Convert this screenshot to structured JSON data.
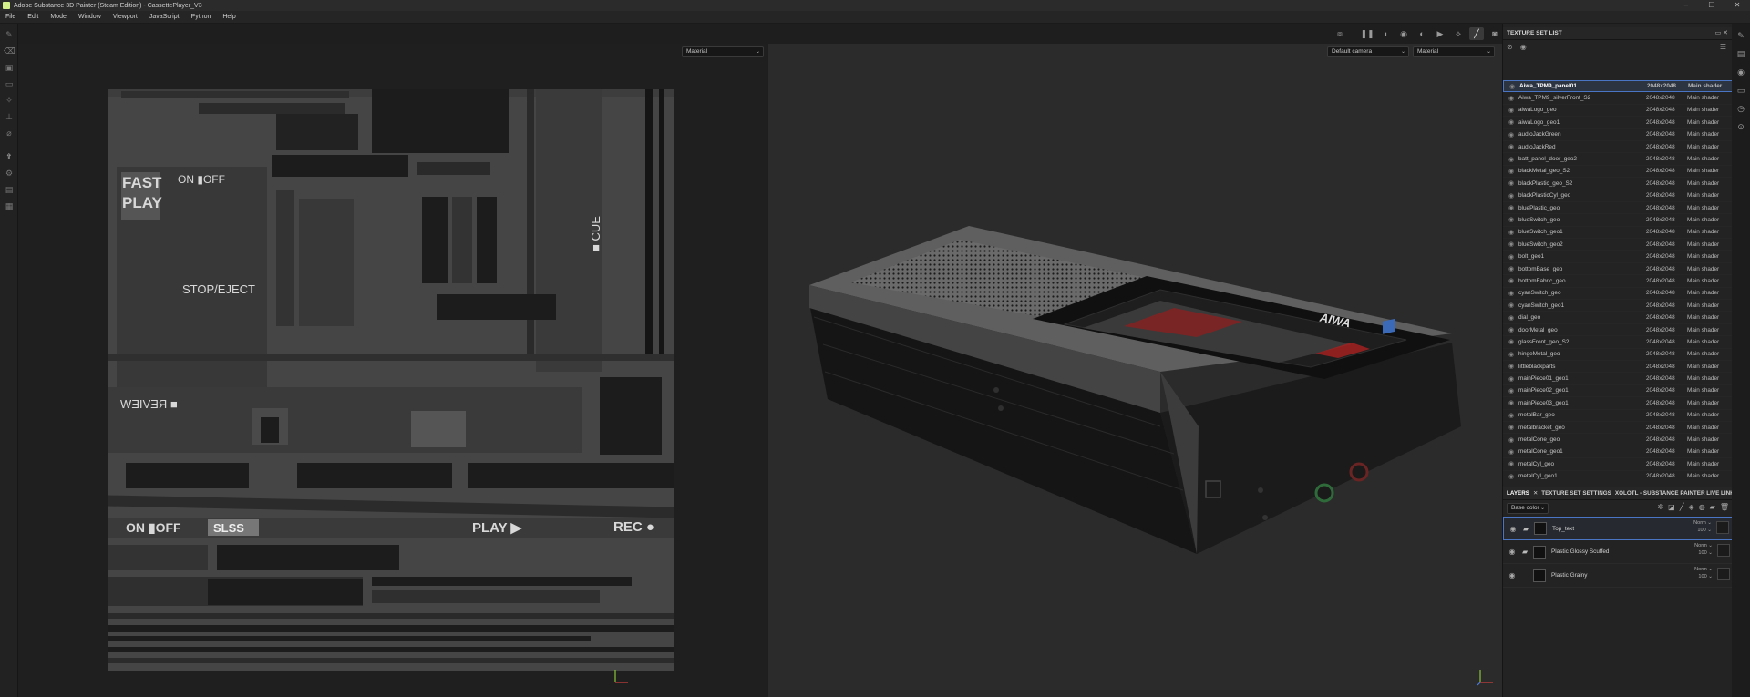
{
  "window": {
    "title": "Adobe Substance 3D Painter (Steam Edition) - CassettePlayer_V3",
    "controls": [
      "–",
      "☐",
      "✕"
    ]
  },
  "menu": [
    "File",
    "Edit",
    "Mode",
    "Window",
    "Viewport",
    "JavaScript",
    "Python",
    "Help"
  ],
  "viewport2d": {
    "channel_dropdown": "Material"
  },
  "viewport3d": {
    "camera_dropdown": "Default camera",
    "channel_dropdown": "Material"
  },
  "uv_labels": {
    "fast": "FAST",
    "play": "PLAY",
    "onoff": "ON ▮OFF",
    "stop_eject": "STOP/EJECT",
    "cue": "■ CUE",
    "review": "■ REVIEW",
    "onoff2": "ON ▮OFF",
    "slss": "SLSS",
    "play2": "PLAY ▶",
    "rec": "REC ●"
  },
  "device_label": "AIWA",
  "texture_set_list": {
    "title": "TEXTURE SET LIST",
    "rows": [
      {
        "name": "Aiwa_TPM9_panel01",
        "res": "2048x2048",
        "shader": "Main shader",
        "selected": true
      },
      {
        "name": "Aiwa_TPM9_silverFront_S2",
        "res": "2048x2048",
        "shader": "Main shader"
      },
      {
        "name": "aiwaLogo_geo",
        "res": "2048x2048",
        "shader": "Main shader"
      },
      {
        "name": "aiwaLogo_geo1",
        "res": "2048x2048",
        "shader": "Main shader"
      },
      {
        "name": "audioJackGreen",
        "res": "2048x2048",
        "shader": "Main shader"
      },
      {
        "name": "audioJackRed",
        "res": "2048x2048",
        "shader": "Main shader"
      },
      {
        "name": "batt_panel_door_geo2",
        "res": "2048x2048",
        "shader": "Main shader"
      },
      {
        "name": "blackMetal_geo_S2",
        "res": "2048x2048",
        "shader": "Main shader"
      },
      {
        "name": "blackPlastic_geo_S2",
        "res": "2048x2048",
        "shader": "Main shader"
      },
      {
        "name": "blackPlasticCyl_geo",
        "res": "2048x2048",
        "shader": "Main shader"
      },
      {
        "name": "bluePlastic_geo",
        "res": "2048x2048",
        "shader": "Main shader"
      },
      {
        "name": "blueSwitch_geo",
        "res": "2048x2048",
        "shader": "Main shader"
      },
      {
        "name": "blueSwitch_geo1",
        "res": "2048x2048",
        "shader": "Main shader"
      },
      {
        "name": "blueSwitch_geo2",
        "res": "2048x2048",
        "shader": "Main shader"
      },
      {
        "name": "bolt_geo1",
        "res": "2048x2048",
        "shader": "Main shader"
      },
      {
        "name": "bottomBase_geo",
        "res": "2048x2048",
        "shader": "Main shader"
      },
      {
        "name": "bottomFabric_geo",
        "res": "2048x2048",
        "shader": "Main shader"
      },
      {
        "name": "cyanSwitch_geo",
        "res": "2048x2048",
        "shader": "Main shader"
      },
      {
        "name": "cyanSwitch_geo1",
        "res": "2048x2048",
        "shader": "Main shader"
      },
      {
        "name": "dial_geo",
        "res": "2048x2048",
        "shader": "Main shader"
      },
      {
        "name": "doorMetal_geo",
        "res": "2048x2048",
        "shader": "Main shader"
      },
      {
        "name": "glassFront_geo_S2",
        "res": "2048x2048",
        "shader": "Main shader"
      },
      {
        "name": "hingeMetal_geo",
        "res": "2048x2048",
        "shader": "Main shader"
      },
      {
        "name": "littleblackparts",
        "res": "2048x2048",
        "shader": "Main shader"
      },
      {
        "name": "mainPiece01_geo1",
        "res": "2048x2048",
        "shader": "Main shader"
      },
      {
        "name": "mainPiece02_geo1",
        "res": "2048x2048",
        "shader": "Main shader"
      },
      {
        "name": "mainPiece03_geo1",
        "res": "2048x2048",
        "shader": "Main shader"
      },
      {
        "name": "metalBar_geo",
        "res": "2048x2048",
        "shader": "Main shader"
      },
      {
        "name": "metalbracket_geo",
        "res": "2048x2048",
        "shader": "Main shader"
      },
      {
        "name": "metalCone_geo",
        "res": "2048x2048",
        "shader": "Main shader"
      },
      {
        "name": "metalCone_geo1",
        "res": "2048x2048",
        "shader": "Main shader"
      },
      {
        "name": "metalCyl_geo",
        "res": "2048x2048",
        "shader": "Main shader"
      },
      {
        "name": "metalCyl_geo1",
        "res": "2048x2048",
        "shader": "Main shader"
      }
    ]
  },
  "layers_panel": {
    "tabs": [
      "LAYERS",
      "✕",
      "TEXTURE SET SETTINGS",
      "XOLOTL - SUBSTANCE PAINTER LIVE LINK"
    ],
    "channel_dropdown": "Base color",
    "layers": [
      {
        "name": "Top_text",
        "blend": "Norm",
        "opacity": "100",
        "selected": true,
        "folder": true
      },
      {
        "name": "Plastic Glossy Scuffed",
        "blend": "Norm",
        "opacity": "100",
        "folder": true
      },
      {
        "name": "Plastic Grainy",
        "blend": "Norm",
        "opacity": "100",
        "folder": false
      }
    ]
  }
}
